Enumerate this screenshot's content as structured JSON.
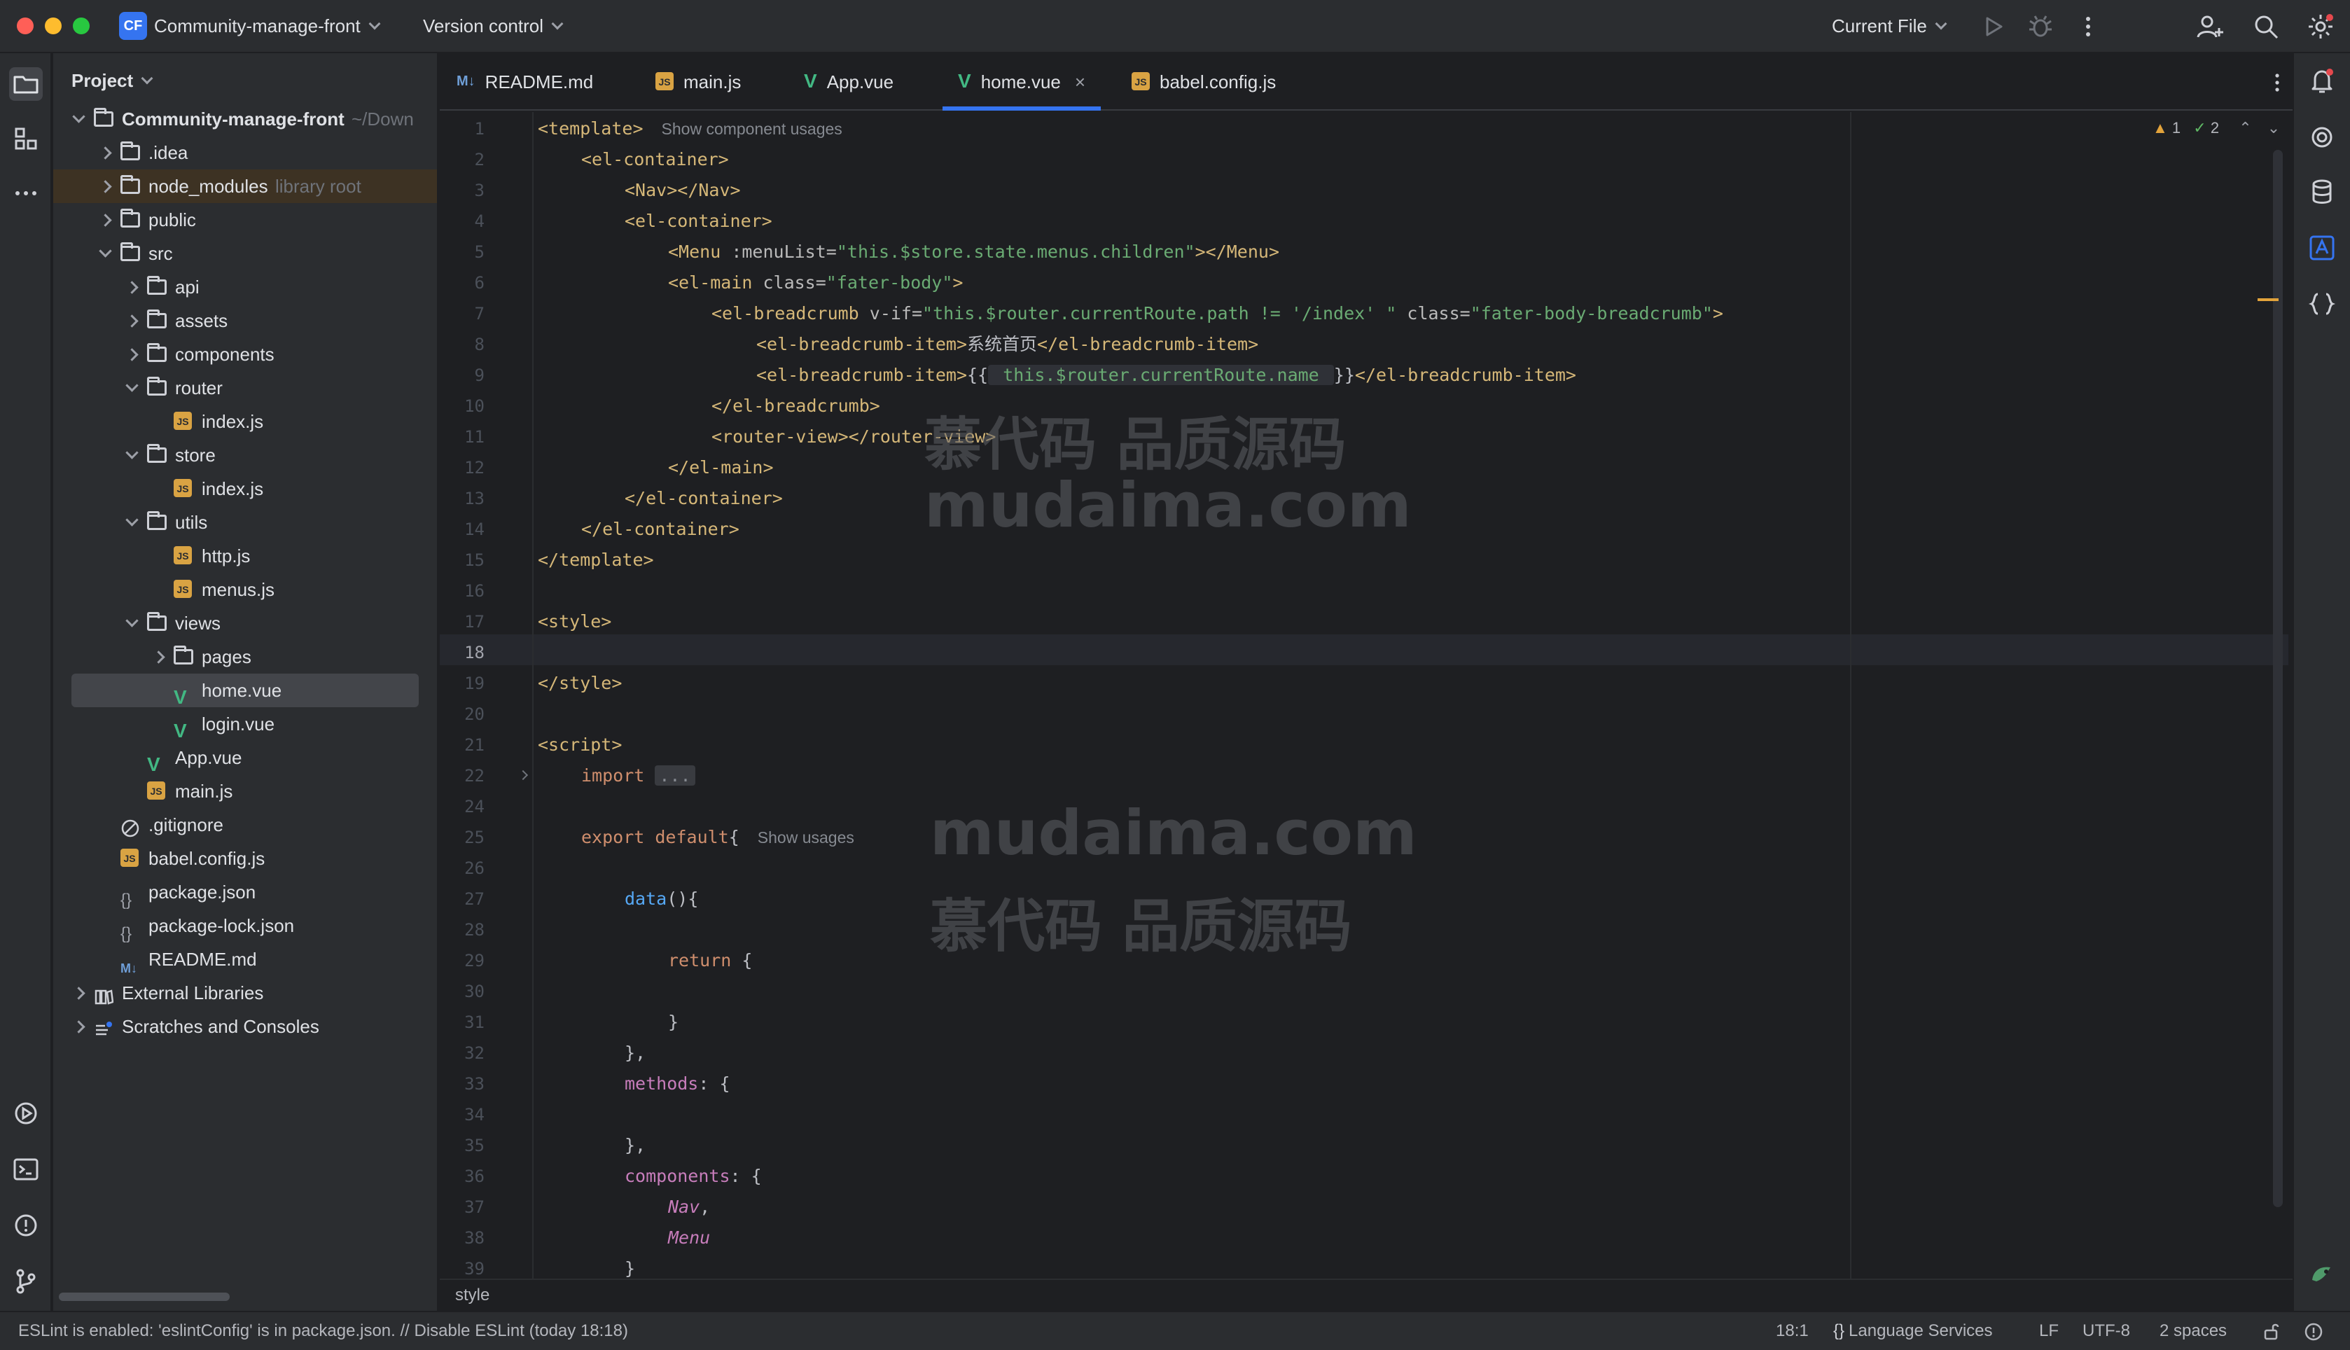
{
  "titlebar": {
    "project_badge": "CF",
    "project_name": "Community-manage-front",
    "vcs_label": "Version control",
    "run_config": "Current File"
  },
  "project_panel": {
    "title": "Project",
    "tree": [
      {
        "label": "Community-manage-front",
        "hint": "~/Down",
        "depth": 0,
        "type": "root",
        "state": "expanded",
        "bold": true
      },
      {
        "label": ".idea",
        "depth": 1,
        "type": "folder",
        "state": "collapsed"
      },
      {
        "label": "node_modules",
        "hint": "library root",
        "depth": 1,
        "type": "folder",
        "state": "collapsed"
      },
      {
        "label": "public",
        "depth": 1,
        "type": "folder",
        "state": "collapsed"
      },
      {
        "label": "src",
        "depth": 1,
        "type": "folder",
        "state": "expanded"
      },
      {
        "label": "api",
        "depth": 2,
        "type": "folder",
        "state": "collapsed"
      },
      {
        "label": "assets",
        "depth": 2,
        "type": "folder",
        "state": "collapsed"
      },
      {
        "label": "components",
        "depth": 2,
        "type": "folder",
        "state": "collapsed"
      },
      {
        "label": "router",
        "depth": 2,
        "type": "folder",
        "state": "expanded"
      },
      {
        "label": "index.js",
        "depth": 3,
        "type": "js"
      },
      {
        "label": "store",
        "depth": 2,
        "type": "folder",
        "state": "expanded"
      },
      {
        "label": "index.js",
        "depth": 3,
        "type": "js"
      },
      {
        "label": "utils",
        "depth": 2,
        "type": "folder",
        "state": "expanded"
      },
      {
        "label": "http.js",
        "depth": 3,
        "type": "js"
      },
      {
        "label": "menus.js",
        "depth": 3,
        "type": "js"
      },
      {
        "label": "views",
        "depth": 2,
        "type": "folder",
        "state": "expanded"
      },
      {
        "label": "pages",
        "depth": 3,
        "type": "folder",
        "state": "collapsed"
      },
      {
        "label": "home.vue",
        "depth": 3,
        "type": "vue",
        "selected": true
      },
      {
        "label": "login.vue",
        "depth": 3,
        "type": "vue"
      },
      {
        "label": "App.vue",
        "depth": 2,
        "type": "vue"
      },
      {
        "label": "main.js",
        "depth": 2,
        "type": "js"
      },
      {
        "label": ".gitignore",
        "depth": 1,
        "type": "ignore"
      },
      {
        "label": "babel.config.js",
        "depth": 1,
        "type": "js"
      },
      {
        "label": "package.json",
        "depth": 1,
        "type": "json"
      },
      {
        "label": "package-lock.json",
        "depth": 1,
        "type": "json"
      },
      {
        "label": "README.md",
        "depth": 1,
        "type": "md"
      },
      {
        "label": "External Libraries",
        "depth": 0,
        "type": "libs",
        "state": "collapsed"
      },
      {
        "label": "Scratches and Consoles",
        "depth": 0,
        "type": "scratch",
        "state": "collapsed"
      }
    ]
  },
  "tabs": [
    {
      "label": "README.md",
      "icon": "md-file-icon",
      "badge": "M↓"
    },
    {
      "label": "main.js",
      "icon": "js-file-icon",
      "badge": "JS"
    },
    {
      "label": "App.vue",
      "icon": "vue-file-icon",
      "badge": "V"
    },
    {
      "label": "home.vue",
      "icon": "vue-file-icon",
      "badge": "V",
      "active": true,
      "close": "×"
    },
    {
      "label": "babel.config.js",
      "icon": "js-file-icon",
      "badge": "JS"
    }
  ],
  "editor": {
    "inspections": {
      "warnings": "1",
      "weak_warnings": "2"
    },
    "line_numbers": [
      "1",
      "2",
      "3",
      "4",
      "5",
      "6",
      "7",
      "8",
      "9",
      "10",
      "11",
      "12",
      "13",
      "14",
      "15",
      "16",
      "17",
      "18",
      "19",
      "20",
      "21",
      "22",
      "24",
      "25",
      "26",
      "27",
      "28",
      "29",
      "30",
      "31",
      "32",
      "33",
      "34",
      "35",
      "36",
      "37",
      "38",
      "39"
    ],
    "current_line": "18",
    "hints": {
      "component_usages": "Show component usages",
      "usages": "Show usages"
    },
    "code": {
      "l1": "<template>",
      "l2": "<el-container>",
      "l3a": "<Nav>",
      "l3b": "</Nav>",
      "l4": "<el-container>",
      "l5a": "<Menu",
      "l5b": " :menuList=",
      "l5c": "\"this.$store.state.menus.children\"",
      "l5d": "></Menu>",
      "l6a": "<el-main",
      "l6b": " class=",
      "l6c": "\"fater-body\"",
      "l6d": ">",
      "l7a": "<el-breadcrumb",
      "l7b": " v-if=",
      "l7c": "\"this.$router.currentRoute.path != '/index' \"",
      "l7d": " class=",
      "l7e": "\"fater-body-breadcrumb\"",
      "l7f": ">",
      "l8a": "<el-breadcrumb-item>",
      "l8b": "系统首页",
      "l8c": "</el-breadcrumb-item>",
      "l9a": "<el-breadcrumb-item>",
      "l9b": "{{",
      "l9c": " this.$router.currentRoute.name ",
      "l9d": "}}",
      "l9e": "</el-breadcrumb-item>",
      "l10": "</el-breadcrumb>",
      "l11a": "<router-view>",
      "l11b": "</router-view>",
      "l12": "</el-main>",
      "l13": "</el-container>",
      "l14": "</el-container>",
      "l15": "</template>",
      "l17": "<style>",
      "l19": "</style>",
      "l21": "<script>",
      "l22a": "import",
      "l22b": "...",
      "l25a": "export default",
      "l25b": "{",
      "l27a": "data",
      "l27b": "(){",
      "l29a": "return",
      "l29b": " {",
      "l31": "}",
      "l32": "},",
      "l33a": "methods",
      "l33b": ": {",
      "l35": "},",
      "l36a": "components",
      "l36b": ": {",
      "l37a": "Nav",
      "l37b": ",",
      "l38": "Menu",
      "l39": "}"
    },
    "watermarks": {
      "cn": "慕代码 品质源码",
      "en": "mudaima.com"
    }
  },
  "breadcrumb": "style",
  "statusbar": {
    "message": "ESLint is enabled: 'eslintConfig' is in package.json. // Disable ESLint (today 18:18)",
    "position": "18:1",
    "language_services": "Language Services",
    "line_sep": "LF",
    "encoding": "UTF-8",
    "indent": "2 spaces"
  },
  "colors": {
    "accent": "#3574f0",
    "tag": "#d5b778",
    "string": "#6aab73",
    "keyword": "#cf8e6d",
    "function": "#56a8f5",
    "property": "#c77dbb",
    "warning": "#e2a33b"
  }
}
